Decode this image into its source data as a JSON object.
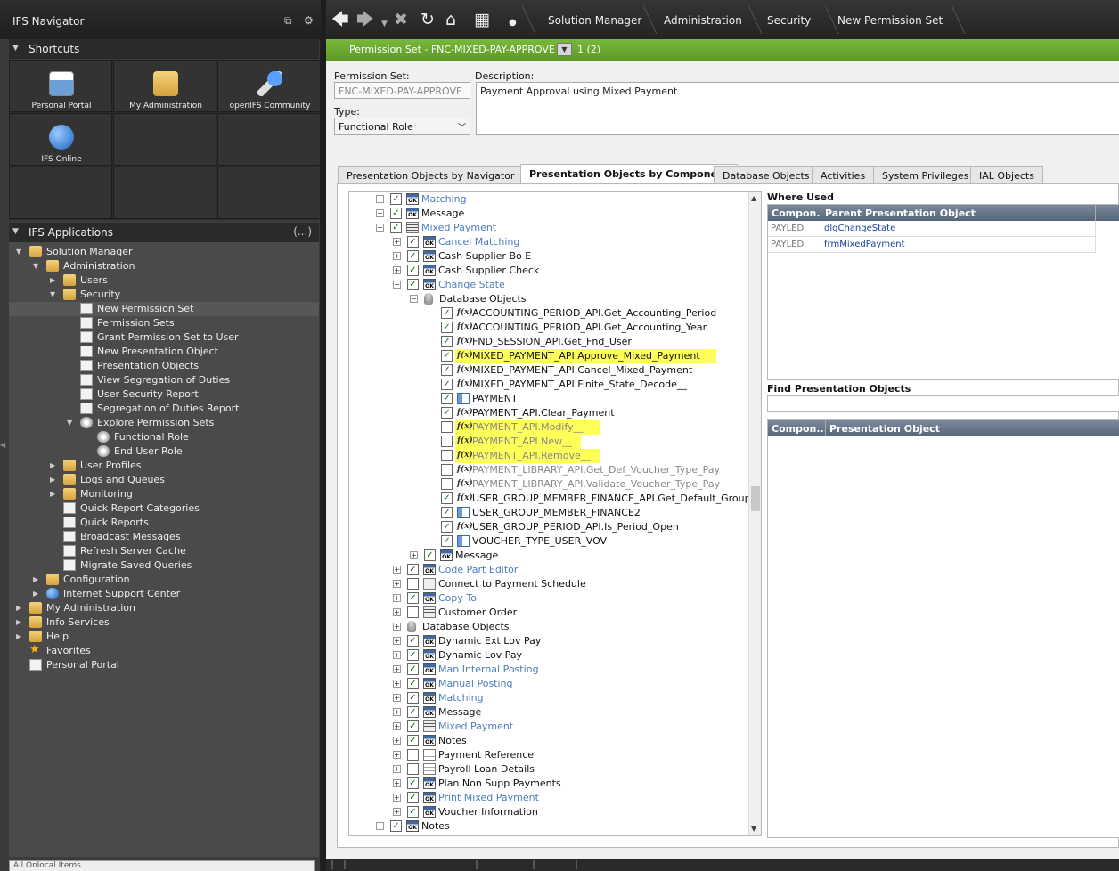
{
  "nav": {
    "title": "IFS Navigator",
    "shortcuts_header": "Shortcuts",
    "shortcuts": [
      {
        "label": "Personal Portal",
        "icon": "calendar-clock-icon"
      },
      {
        "label": "My Administration",
        "icon": "folder-icon"
      },
      {
        "label": "openIFS Community",
        "icon": "phone-help-icon"
      },
      {
        "label": "IFS Online",
        "icon": "globe-icon"
      }
    ],
    "apps_header": "IFS Applications",
    "apps_more": "(...)",
    "tree": [
      {
        "label": "Solution Manager",
        "level": 0,
        "exp": "open",
        "icon": "folder"
      },
      {
        "label": "Administration",
        "level": 1,
        "exp": "open",
        "icon": "folder"
      },
      {
        "label": "Users",
        "level": 2,
        "exp": "closed",
        "icon": "folder"
      },
      {
        "label": "Security",
        "level": 2,
        "exp": "open",
        "icon": "folder"
      },
      {
        "label": "New Permission Set",
        "level": 3,
        "exp": "none",
        "icon": "page",
        "selected": true
      },
      {
        "label": "Permission Sets",
        "level": 3,
        "exp": "none",
        "icon": "page"
      },
      {
        "label": "Grant Permission Set to User",
        "level": 3,
        "exp": "none",
        "icon": "page"
      },
      {
        "label": "New Presentation Object",
        "level": 3,
        "exp": "none",
        "icon": "page"
      },
      {
        "label": "Presentation Objects",
        "level": 3,
        "exp": "none",
        "icon": "page"
      },
      {
        "label": "View Segregation of Duties",
        "level": 3,
        "exp": "none",
        "icon": "page"
      },
      {
        "label": "User Security Report",
        "level": 3,
        "exp": "none",
        "icon": "page"
      },
      {
        "label": "Segregation of Duties Report",
        "level": 3,
        "exp": "none",
        "icon": "page"
      },
      {
        "label": "Explore Permission Sets",
        "level": 3,
        "exp": "open",
        "icon": "gear"
      },
      {
        "label": "Functional Role",
        "level": 4,
        "exp": "none",
        "icon": "gear"
      },
      {
        "label": "End User Role",
        "level": 4,
        "exp": "none",
        "icon": "gear"
      },
      {
        "label": "User Profiles",
        "level": 2,
        "exp": "closed",
        "icon": "folder"
      },
      {
        "label": "Logs and Queues",
        "level": 2,
        "exp": "closed",
        "icon": "folder"
      },
      {
        "label": "Monitoring",
        "level": 2,
        "exp": "closed",
        "icon": "folder"
      },
      {
        "label": "Quick Report Categories",
        "level": 2,
        "exp": "none",
        "icon": "page"
      },
      {
        "label": "Quick Reports",
        "level": 2,
        "exp": "none",
        "icon": "page"
      },
      {
        "label": "Broadcast Messages",
        "level": 2,
        "exp": "none",
        "icon": "page"
      },
      {
        "label": "Refresh Server Cache",
        "level": 2,
        "exp": "none",
        "icon": "page"
      },
      {
        "label": "Migrate Saved Queries",
        "level": 2,
        "exp": "none",
        "icon": "page"
      },
      {
        "label": "Configuration",
        "level": 1,
        "exp": "closed",
        "icon": "folder"
      },
      {
        "label": "Internet Support Center",
        "level": 1,
        "exp": "closed",
        "icon": "globe"
      },
      {
        "label": "My Administration",
        "level": 0,
        "exp": "closed",
        "icon": "folder"
      },
      {
        "label": "Info Services",
        "level": 0,
        "exp": "closed",
        "icon": "folder"
      },
      {
        "label": "Help",
        "level": 0,
        "exp": "closed",
        "icon": "folder"
      },
      {
        "label": "Favorites",
        "level": 0,
        "exp": "none",
        "icon": "star"
      },
      {
        "label": "Personal Portal",
        "level": 0,
        "exp": "none",
        "icon": "page"
      }
    ],
    "search_placeholder": "All Onlocal Items"
  },
  "toolbar": {
    "breadcrumbs": [
      "Solution Manager",
      "Administration",
      "Security",
      "New Permission Set"
    ]
  },
  "main": {
    "title": "Permission Set - FNC-MIXED-PAY-APPROVE",
    "record_count": "1 (2)",
    "permission_set_label": "Permission Set:",
    "permission_set_value": "FNC-MIXED-PAY-APPROVE",
    "description_label": "Description:",
    "description_value": "Payment Approval using Mixed Payment",
    "type_label": "Type:",
    "type_value": "Functional Role",
    "tabs": [
      {
        "label": "Presentation Objects by Navigator",
        "active": false
      },
      {
        "label": "Presentation Objects by Component",
        "active": true
      },
      {
        "label": "Database Objects",
        "active": false
      },
      {
        "label": "Activities",
        "active": false
      },
      {
        "label": "System Privileges",
        "active": false
      },
      {
        "label": "IAL Objects",
        "active": false
      }
    ]
  },
  "component_tree": [
    {
      "label": "Matching",
      "level": 2,
      "checked": true,
      "icon": "win",
      "style": "blue",
      "exp": "plus"
    },
    {
      "label": "Message",
      "level": 2,
      "checked": true,
      "icon": "win",
      "style": "normal",
      "exp": "plus"
    },
    {
      "label": "Mixed Payment",
      "level": 2,
      "checked": true,
      "icon": "lst",
      "style": "blue",
      "exp": "minus"
    },
    {
      "label": "Cancel Matching",
      "level": 3,
      "checked": true,
      "icon": "win",
      "style": "blue",
      "exp": "plus"
    },
    {
      "label": "Cash Supplier Bo E",
      "level": 3,
      "checked": true,
      "icon": "win",
      "style": "normal",
      "exp": "plus"
    },
    {
      "label": "Cash Supplier Check",
      "level": 3,
      "checked": true,
      "icon": "win",
      "style": "normal",
      "exp": "plus"
    },
    {
      "label": "Change State",
      "level": 3,
      "checked": true,
      "icon": "win",
      "style": "blue",
      "exp": "minus"
    },
    {
      "label": "Database Objects",
      "level": 4,
      "checked": null,
      "icon": "db",
      "style": "normal",
      "exp": "minus"
    },
    {
      "label": "ACCOUNTING_PERIOD_API.Get_Accounting_Period",
      "level": 5,
      "checked": true,
      "icon": "fx",
      "style": "normal",
      "exp": "none"
    },
    {
      "label": "ACCOUNTING_PERIOD_API.Get_Accounting_Year",
      "level": 5,
      "checked": true,
      "icon": "fx",
      "style": "normal",
      "exp": "none"
    },
    {
      "label": "FND_SESSION_API.Get_Fnd_User",
      "level": 5,
      "checked": true,
      "icon": "fx",
      "style": "normal",
      "exp": "none"
    },
    {
      "label": "MIXED_PAYMENT_API.Approve_Mixed_Payment",
      "level": 5,
      "checked": true,
      "icon": "fx",
      "style": "normal",
      "exp": "none",
      "highlight": true
    },
    {
      "label": "MIXED_PAYMENT_API.Cancel_Mixed_Payment",
      "level": 5,
      "checked": true,
      "icon": "fx",
      "style": "normal",
      "exp": "none"
    },
    {
      "label": "MIXED_PAYMENT_API.Finite_State_Decode__",
      "level": 5,
      "checked": true,
      "icon": "fx",
      "style": "normal",
      "exp": "none"
    },
    {
      "label": "PAYMENT",
      "level": 5,
      "checked": true,
      "icon": "ent",
      "style": "normal",
      "exp": "none"
    },
    {
      "label": "PAYMENT_API.Clear_Payment",
      "level": 5,
      "checked": true,
      "icon": "fx",
      "style": "normal",
      "exp": "none"
    },
    {
      "label": "PAYMENT_API.Modify__",
      "level": 5,
      "checked": false,
      "icon": "fx",
      "style": "dis",
      "exp": "none",
      "highlight": true
    },
    {
      "label": "PAYMENT_API.New__",
      "level": 5,
      "checked": false,
      "icon": "fx",
      "style": "dis",
      "exp": "none",
      "highlight": true
    },
    {
      "label": "PAYMENT_API.Remove__",
      "level": 5,
      "checked": false,
      "icon": "fx",
      "style": "dis",
      "exp": "none",
      "highlight": true
    },
    {
      "label": "PAYMENT_LIBRARY_API.Get_Def_Voucher_Type_Pay",
      "level": 5,
      "checked": false,
      "icon": "fx",
      "style": "dis",
      "exp": "none"
    },
    {
      "label": "PAYMENT_LIBRARY_API.Validate_Voucher_Type_Pay",
      "level": 5,
      "checked": false,
      "icon": "fx",
      "style": "dis",
      "exp": "none"
    },
    {
      "label": "USER_GROUP_MEMBER_FINANCE_API.Get_Default_Group",
      "level": 5,
      "checked": true,
      "icon": "fx",
      "style": "normal",
      "exp": "none"
    },
    {
      "label": "USER_GROUP_MEMBER_FINANCE2",
      "level": 5,
      "checked": true,
      "icon": "ent",
      "style": "normal",
      "exp": "none"
    },
    {
      "label": "USER_GROUP_PERIOD_API.Is_Period_Open",
      "level": 5,
      "checked": true,
      "icon": "fx",
      "style": "normal",
      "exp": "none"
    },
    {
      "label": "VOUCHER_TYPE_USER_VOV",
      "level": 5,
      "checked": true,
      "icon": "ent",
      "style": "normal",
      "exp": "none"
    },
    {
      "label": "Message",
      "level": 4,
      "checked": true,
      "icon": "win",
      "style": "normal",
      "exp": "plus"
    },
    {
      "label": "Code Part Editor",
      "level": 3,
      "checked": true,
      "icon": "win",
      "style": "blue",
      "exp": "plus"
    },
    {
      "label": "Connect to Payment Schedule",
      "level": 3,
      "checked": false,
      "icon": "dgl",
      "style": "normal",
      "exp": "plus"
    },
    {
      "label": "Copy To",
      "level": 3,
      "checked": true,
      "icon": "win",
      "style": "blue",
      "exp": "plus"
    },
    {
      "label": "Customer Order",
      "level": 3,
      "checked": false,
      "icon": "lst",
      "style": "normal",
      "exp": "plus"
    },
    {
      "label": "Database Objects",
      "level": 3,
      "checked": null,
      "icon": "db",
      "style": "normal",
      "exp": "plus"
    },
    {
      "label": "Dynamic Ext Lov Pay",
      "level": 3,
      "checked": true,
      "icon": "win",
      "style": "normal",
      "exp": "plus"
    },
    {
      "label": "Dynamic Lov Pay",
      "level": 3,
      "checked": true,
      "icon": "win",
      "style": "normal",
      "exp": "plus"
    },
    {
      "label": "Man Internal Posting",
      "level": 3,
      "checked": true,
      "icon": "win",
      "style": "blue",
      "exp": "plus"
    },
    {
      "label": "Manual Posting",
      "level": 3,
      "checked": true,
      "icon": "win",
      "style": "blue",
      "exp": "plus"
    },
    {
      "label": "Matching",
      "level": 3,
      "checked": true,
      "icon": "win",
      "style": "blue",
      "exp": "plus"
    },
    {
      "label": "Message",
      "level": 3,
      "checked": true,
      "icon": "win",
      "style": "normal",
      "exp": "plus"
    },
    {
      "label": "Mixed Payment",
      "level": 3,
      "checked": true,
      "icon": "lst",
      "style": "blue",
      "exp": "plus"
    },
    {
      "label": "Notes",
      "level": 3,
      "checked": true,
      "icon": "win",
      "style": "normal",
      "exp": "plus"
    },
    {
      "label": "Payment Reference",
      "level": 3,
      "checked": false,
      "icon": "tbl",
      "style": "normal",
      "exp": "plus"
    },
    {
      "label": "Payroll Loan Details",
      "level": 3,
      "checked": false,
      "icon": "tbl",
      "style": "normal",
      "exp": "plus"
    },
    {
      "label": "Plan Non Supp Payments",
      "level": 3,
      "checked": true,
      "icon": "win",
      "style": "normal",
      "exp": "plus"
    },
    {
      "label": "Print Mixed Payment",
      "level": 3,
      "checked": true,
      "icon": "win",
      "style": "blue",
      "exp": "plus"
    },
    {
      "label": "Voucher Information",
      "level": 3,
      "checked": true,
      "icon": "win",
      "style": "normal",
      "exp": "plus"
    },
    {
      "label": "Notes",
      "level": 2,
      "checked": true,
      "icon": "win",
      "style": "normal",
      "exp": "plus"
    }
  ],
  "where_used": {
    "label": "Where Used",
    "columns": [
      "Compon...",
      "Parent Presentation Object"
    ],
    "rows": [
      {
        "component": "PAYLED",
        "parent": "dlgChangeState"
      },
      {
        "component": "PAYLED",
        "parent": "frmMixedPayment"
      }
    ]
  },
  "find_objects": {
    "label": "Find Presentation Objects",
    "columns": [
      "Compon...",
      "Presentation Object"
    ]
  }
}
